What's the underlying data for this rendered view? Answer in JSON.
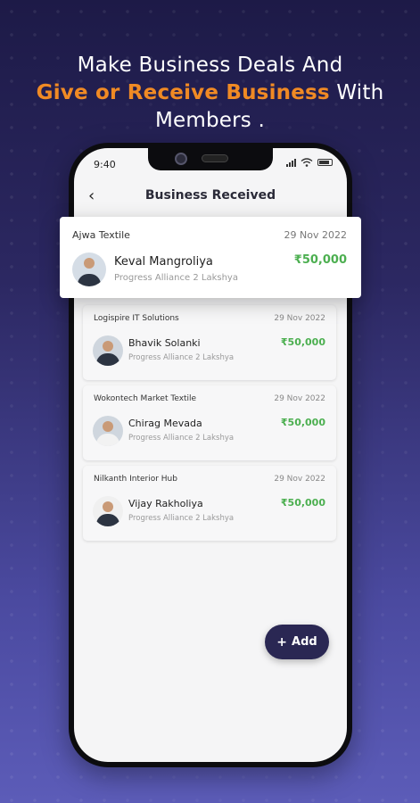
{
  "headline": {
    "line1": "Make Business Deals And",
    "accent": "Give or Receive Business",
    "line2_rest": " With",
    "line3": "Members ."
  },
  "status_bar": {
    "time": "9:40"
  },
  "app_bar": {
    "title": "Business Received"
  },
  "highlight_card": {
    "company": "Ajwa Textile",
    "date": "29 Nov 2022",
    "name": "Keval Mangroliya",
    "amount": "₹50,000",
    "group": "Progress Alliance 2 Lakshya"
  },
  "cards": [
    {
      "company": "Logispire IT Solutions",
      "date": "29 Nov 2022",
      "name": "Bhavik Solanki",
      "amount": "₹50,000",
      "group": "Progress Alliance 2 Lakshya"
    },
    {
      "company": "Wokontech Market Textile",
      "date": "29 Nov 2022",
      "name": "Chirag Mevada",
      "amount": "₹50,000",
      "group": "Progress Alliance 2 Lakshya"
    },
    {
      "company": "Nilkanth Interior Hub",
      "date": "29 Nov 2022",
      "name": "Vijay Rakholiya",
      "amount": "₹50,000",
      "group": "Progress Alliance 2 Lakshya"
    }
  ],
  "fab": {
    "label": "Add",
    "icon": "plus-icon"
  },
  "colors": {
    "accent": "#f08a24",
    "amount": "#4caf50",
    "fab": "#2a2753",
    "background_top": "#1d1a47",
    "background_bottom": "#5c5cb8"
  }
}
